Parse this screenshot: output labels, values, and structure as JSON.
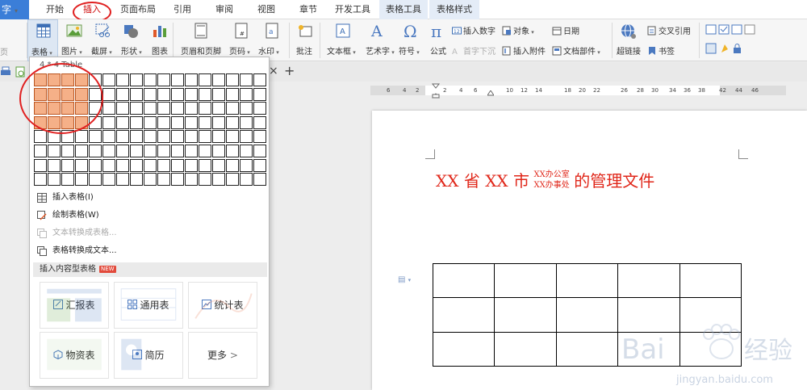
{
  "app": {
    "label": "字",
    "caret": "▾"
  },
  "tabs": [
    {
      "id": "start",
      "label": "开始"
    },
    {
      "id": "insert",
      "label": "插入"
    },
    {
      "id": "layout",
      "label": "页面布局"
    },
    {
      "id": "reference",
      "label": "引用"
    },
    {
      "id": "review",
      "label": "审阅"
    },
    {
      "id": "view",
      "label": "视图"
    },
    {
      "id": "section",
      "label": "章节"
    },
    {
      "id": "dev",
      "label": "开发工具"
    },
    {
      "id": "tabletool",
      "label": "表格工具"
    },
    {
      "id": "tablestyle",
      "label": "表格样式"
    }
  ],
  "ribbon": {
    "left_cut": "页",
    "table": "表格",
    "picture": "图片",
    "screenshot": "截屏",
    "shape": "形状",
    "chart": "图表",
    "header_footer": "页眉和页脚",
    "page_number": "页码",
    "watermark": "水印",
    "comment": "批注",
    "textbox": "文本框",
    "wordart": "艺术字",
    "symbol": "符号",
    "formula": "公式",
    "insert_number": "插入数字",
    "object": "对象",
    "date": "日期",
    "drop_cap": "首字下沉",
    "attachment": "插入附件",
    "doc_parts": "文档部件",
    "hyperlink": "超链接",
    "cross_ref": "交叉引用",
    "bookmark": "书签"
  },
  "doc_strip": {
    "close": "×",
    "add": "+"
  },
  "ruler_labels": [
    "6",
    "4",
    "2",
    "2",
    "4",
    "6",
    "10",
    "12",
    "14",
    "18",
    "20",
    "22",
    "26",
    "28",
    "30",
    "34",
    "36",
    "38",
    "42",
    "44",
    "46"
  ],
  "dropdown": {
    "grid_label": "4 * 4 Table",
    "grid_cols": 17,
    "grid_rows": 8,
    "selected_cols": 4,
    "selected_rows": 4,
    "menu": [
      {
        "label": "插入表格(I)",
        "disabled": false
      },
      {
        "label": "绘制表格(W)",
        "disabled": false
      },
      {
        "label": "文本转换成表格...",
        "disabled": true
      },
      {
        "label": "表格转换成文本...",
        "disabled": false
      }
    ],
    "content_header": "插入内容型表格",
    "new_badge": "NEW",
    "cards": [
      {
        "label": "汇报表",
        "icon": "report-icon"
      },
      {
        "label": "通用表",
        "icon": "grid-icon"
      },
      {
        "label": "统计表",
        "icon": "stats-icon"
      },
      {
        "label": "物资表",
        "icon": "box-icon"
      },
      {
        "label": "简历",
        "icon": "resume-icon"
      },
      {
        "label": "更多",
        "icon": "chevron-right-icon",
        "suffix": ">"
      }
    ]
  },
  "document": {
    "title_part1": "XX 省 XX 市",
    "title_upper": "XX办公室",
    "title_lower": "XX办事处",
    "title_part2": "的管理文件",
    "table_rows": 3,
    "table_cols": 5
  },
  "watermark": {
    "brand": "Bai",
    "brand2": "经验",
    "url": "jingyan.baidu.com"
  },
  "colors": {
    "title_red": "#e0271a",
    "app_blue": "#3b7ed8",
    "cell_orange": "#f5b088",
    "annotation_red": "#e02020"
  }
}
